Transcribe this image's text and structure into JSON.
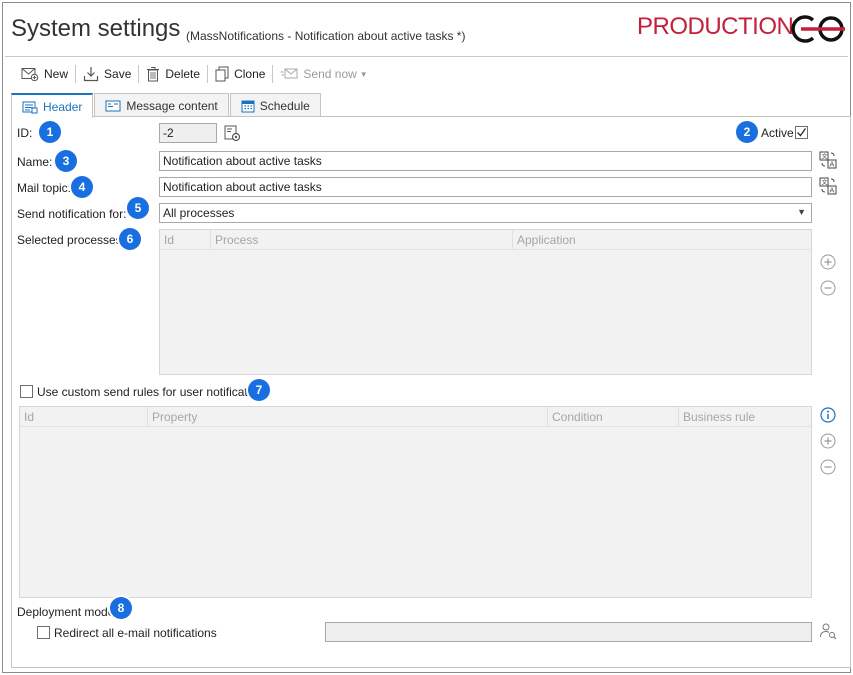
{
  "window": {
    "title": "System settings",
    "subtitle": "(MassNotifications - Notification about active tasks *)",
    "environment": "PRODUCTION",
    "environment_color": "#c2203b"
  },
  "toolbar": {
    "new_label": "New",
    "save_label": "Save",
    "delete_label": "Delete",
    "clone_label": "Clone",
    "send_now_label": "Send now"
  },
  "tabs": [
    {
      "label": "Header",
      "active": true
    },
    {
      "label": "Message content",
      "active": false
    },
    {
      "label": "Schedule",
      "active": false
    }
  ],
  "form": {
    "id_label": "ID:",
    "id_value": "-2",
    "active_label": "Active",
    "active_checked": true,
    "name_label": "Name:",
    "name_value": "Notification about active tasks",
    "mail_topic_label": "Mail topic:",
    "mail_topic_value": "Notification about active tasks",
    "send_for_label": "Send notification for:",
    "send_for_value": "All processes",
    "selected_processes_label": "Selected processes:",
    "processes_columns": [
      "Id",
      "Process",
      "Application"
    ],
    "custom_rules_label": "Use custom send rules for user notifications",
    "custom_rules_checked": false,
    "rules_columns": [
      "Id",
      "Property",
      "Condition",
      "Business rule"
    ],
    "deployment_label": "Deployment mode:",
    "redirect_label": "Redirect all e-mail notifications",
    "redirect_checked": false,
    "redirect_value": ""
  },
  "badges": [
    "1",
    "2",
    "3",
    "4",
    "5",
    "6",
    "7",
    "8"
  ],
  "colors": {
    "accent": "#1e73be",
    "badge": "#1a6fe0"
  }
}
